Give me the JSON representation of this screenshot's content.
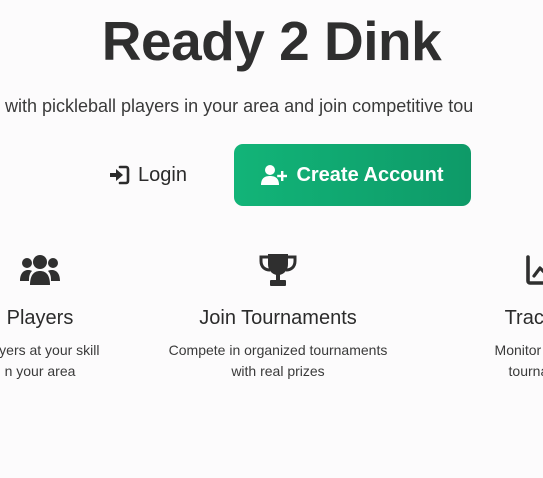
{
  "hero": {
    "title": "Ready 2 Dink",
    "subtitle": "with pickleball players in your area and join competitive tou"
  },
  "actions": {
    "login_label": "Login",
    "create_account_label": "Create Account"
  },
  "features": [
    {
      "icon": "users-icon",
      "title": "Players",
      "desc_line1": "players at your skill",
      "desc_line2": "n your area"
    },
    {
      "icon": "trophy-icon",
      "title": "Join Tournaments",
      "desc_line1": "Compete in organized tournaments",
      "desc_line2": "with real prizes"
    },
    {
      "icon": "chart-icon",
      "title": "Track Pr",
      "desc_line1": "Monitor your wi",
      "desc_line2": "tournamen"
    }
  ],
  "colors": {
    "accent": "#10a870",
    "text": "#2b2b2b",
    "background": "#fcfbfc"
  }
}
